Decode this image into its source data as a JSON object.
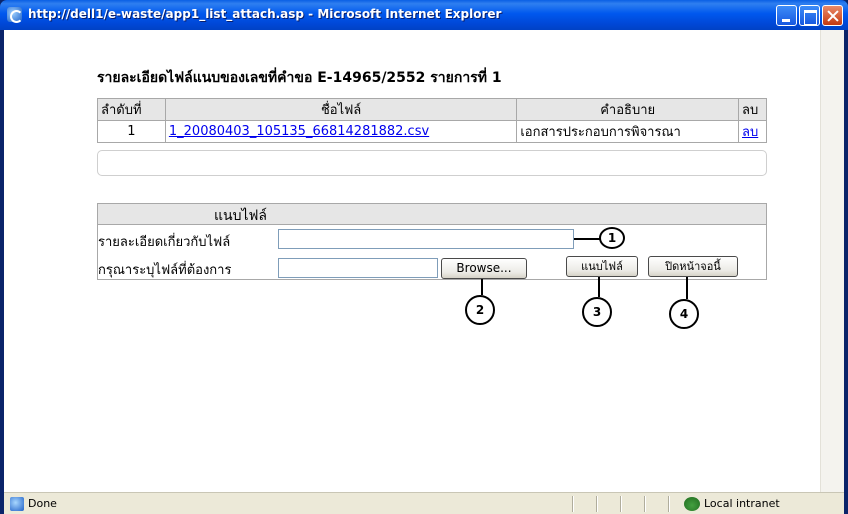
{
  "window": {
    "title": "http://dell1/e-waste/app1_list_attach.asp - Microsoft Internet Explorer"
  },
  "page": {
    "title": "รายละเอียดไฟล์แนบของเลขที่คำขอ E-14965/2552 รายการที่ 1"
  },
  "files_table": {
    "headers": [
      "ลำดับที่",
      "ชื่อไฟล์",
      "คำอธิบาย",
      "ลบ"
    ],
    "rows": [
      {
        "order": "1",
        "file_name": "1_20080403_105135_66814281882.csv",
        "description": "เอกสารประกอบการพิจารณา",
        "delete": "ลบ"
      }
    ]
  },
  "attach_form": {
    "heading": "แนบไฟล์",
    "description_label": "รายละเอียดเกี่ยวกับไฟล์",
    "description_value": "",
    "file_label": "กรุณาระบุไฟล์ที่ต้องการ",
    "file_value": "",
    "browse_label": "Browse...",
    "attach_label": "แนบไฟล์",
    "close_label": "ปิดหน้าจอนี้"
  },
  "callouts": [
    "1",
    "2",
    "3",
    "4"
  ],
  "status": {
    "text": "Done",
    "zone": "Local intranet"
  },
  "icons": {
    "app": "ie-icon",
    "status": "ie-page-icon",
    "zone": "intranet-globe-icon"
  }
}
